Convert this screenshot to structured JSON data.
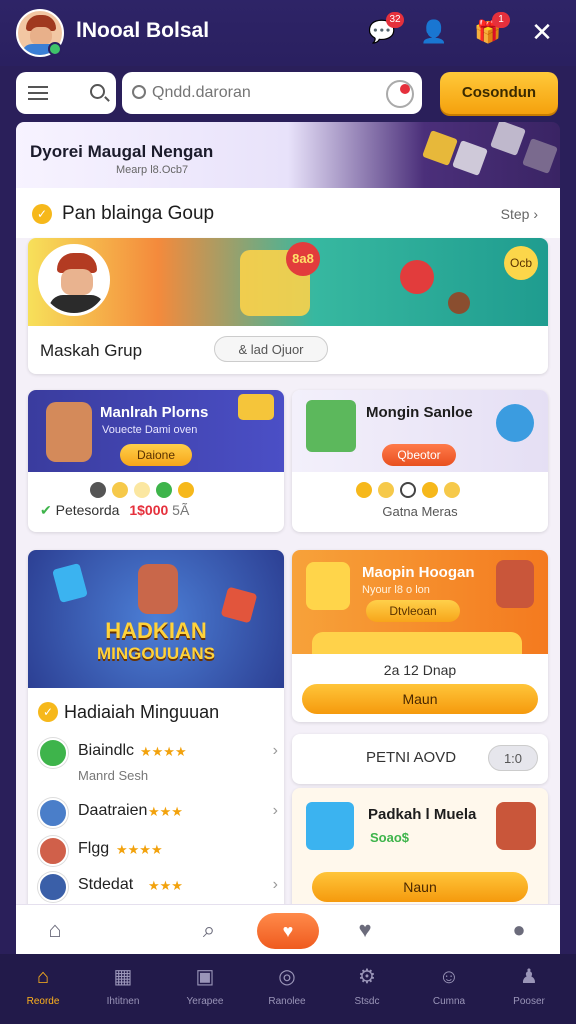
{
  "header": {
    "app_title": "lNooal Bolsal",
    "notification_badge": "32",
    "gift_badge": "1"
  },
  "search": {
    "placeholder": "Qndd.daroran",
    "cta_label": "Cosondun"
  },
  "banner": {
    "title": "Dyorei Maugal Nengan",
    "subtitle": "Mearp l8.Ocb7"
  },
  "section": {
    "title": "Pan blainga Goup",
    "more_label": "Step"
  },
  "hero": {
    "label": "Maskah Grup",
    "pill": "& lad Ojuor",
    "tag": "8a8",
    "coin": "Ocb"
  },
  "card_left1": {
    "title": "Manlrah Plorns",
    "subtitle": "Vouecte Dami oven",
    "button": "Daione",
    "footer_text": "Petesorda",
    "footer_value": "1$000",
    "footer_suffix": "5Ã"
  },
  "card_right1": {
    "title": "Mongin Sanloe",
    "button": "Qbeotor",
    "footer_text": "Gatna Meras"
  },
  "card_left2": {
    "art_line1": "HADKIAN",
    "art_line2": "MINGOUUANS",
    "heading": "Hadiaiah Minguuan",
    "items": [
      {
        "name": "Biaindlc",
        "stars": "★★★★",
        "sub": "Manrd Sesh"
      },
      {
        "name": "Daatraien",
        "stars": "★★★"
      },
      {
        "name": "Flgg",
        "stars": "★★★★"
      },
      {
        "name": "Stdedat",
        "stars": "★★★"
      }
    ]
  },
  "card_right2": {
    "title": "Maopin Hoogan",
    "subtitle": "Nyour l8 o lon",
    "button": "Dtvleoan",
    "info": "2a 12 Dnap",
    "action": "Maun"
  },
  "card_right3": {
    "label": "PETNI AOVD",
    "pill": "1:0"
  },
  "card_right4": {
    "title": "Padkah l Muela",
    "subtitle": "Soao$",
    "action": "Naun"
  },
  "tabs": [
    {
      "label": "Reorde",
      "icon": "home-icon",
      "active": true
    },
    {
      "label": "Ihtitnen",
      "icon": "store-icon"
    },
    {
      "label": "Yerapee",
      "icon": "board-icon"
    },
    {
      "label": "Ranolee",
      "icon": "globe-icon"
    },
    {
      "label": "Stsdc",
      "icon": "settings-icon"
    },
    {
      "label": "Cumna",
      "icon": "chat-icon"
    },
    {
      "label": "Pooser",
      "icon": "profile-icon"
    }
  ],
  "colors": {
    "brand_dark": "#2a1f5a",
    "accent_orange": "#f59a0d",
    "accent_red": "#ef5b1f"
  }
}
